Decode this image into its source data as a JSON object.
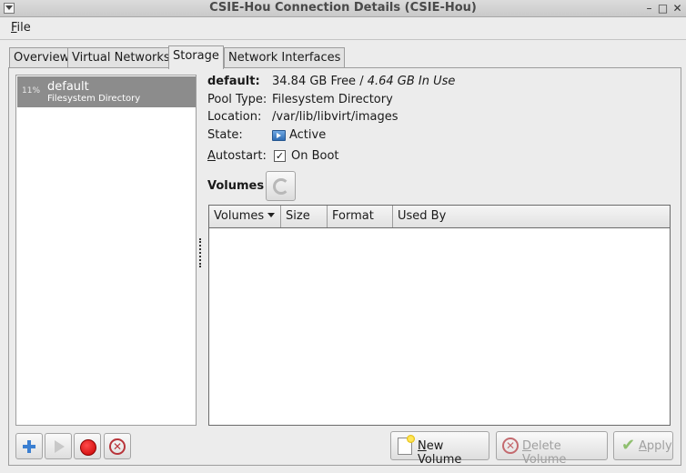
{
  "window": {
    "title": "CSIE-Hou Connection Details (CSIE-Hou)",
    "minimize_glyph": "–",
    "maximize_glyph": "□",
    "close_glyph": "✕"
  },
  "menubar": {
    "file": "File"
  },
  "tabs": [
    {
      "label": "Overview"
    },
    {
      "label": "Virtual Networks"
    },
    {
      "label": "Storage"
    },
    {
      "label": "Network Interfaces"
    }
  ],
  "active_tab": "Storage",
  "pool_list": {
    "items": [
      {
        "percent": "11%",
        "name": "default",
        "type": "Filesystem Directory",
        "selected": true
      }
    ]
  },
  "details": {
    "name": "default:",
    "free": "34.84 GB Free",
    "separator": " / ",
    "in_use": "4.64 GB In Use",
    "pool_type_label": "Pool Type:",
    "pool_type": "Filesystem Directory",
    "location_label": "Location:",
    "location": "/var/lib/libvirt/images",
    "state_label": "State:",
    "state": "Active",
    "autostart_label": "Autostart:",
    "autostart_value": "On Boot",
    "autostart_checked": true,
    "checkmark": "✓"
  },
  "volumes": {
    "label": "Volumes",
    "columns": [
      "Volumes",
      "Size",
      "Format",
      "Used By"
    ],
    "rows": []
  },
  "toolbar": {
    "new_volume": "New Volume",
    "delete_volume": "Delete Volume",
    "apply": "Apply",
    "x_glyph": "✕",
    "check_glyph": "✔"
  },
  "icons": {
    "add_pool": "plus-icon",
    "start_pool": "play-icon",
    "stop_pool": "stop-icon",
    "delete_pool": "delete-icon",
    "refresh": "refresh-icon",
    "state": "running-icon"
  },
  "colors": {
    "selection": "#8c8c8c",
    "accent_blue": "#3b7fd1",
    "stop_red": "#c80000",
    "delete_red": "#b8343a"
  }
}
